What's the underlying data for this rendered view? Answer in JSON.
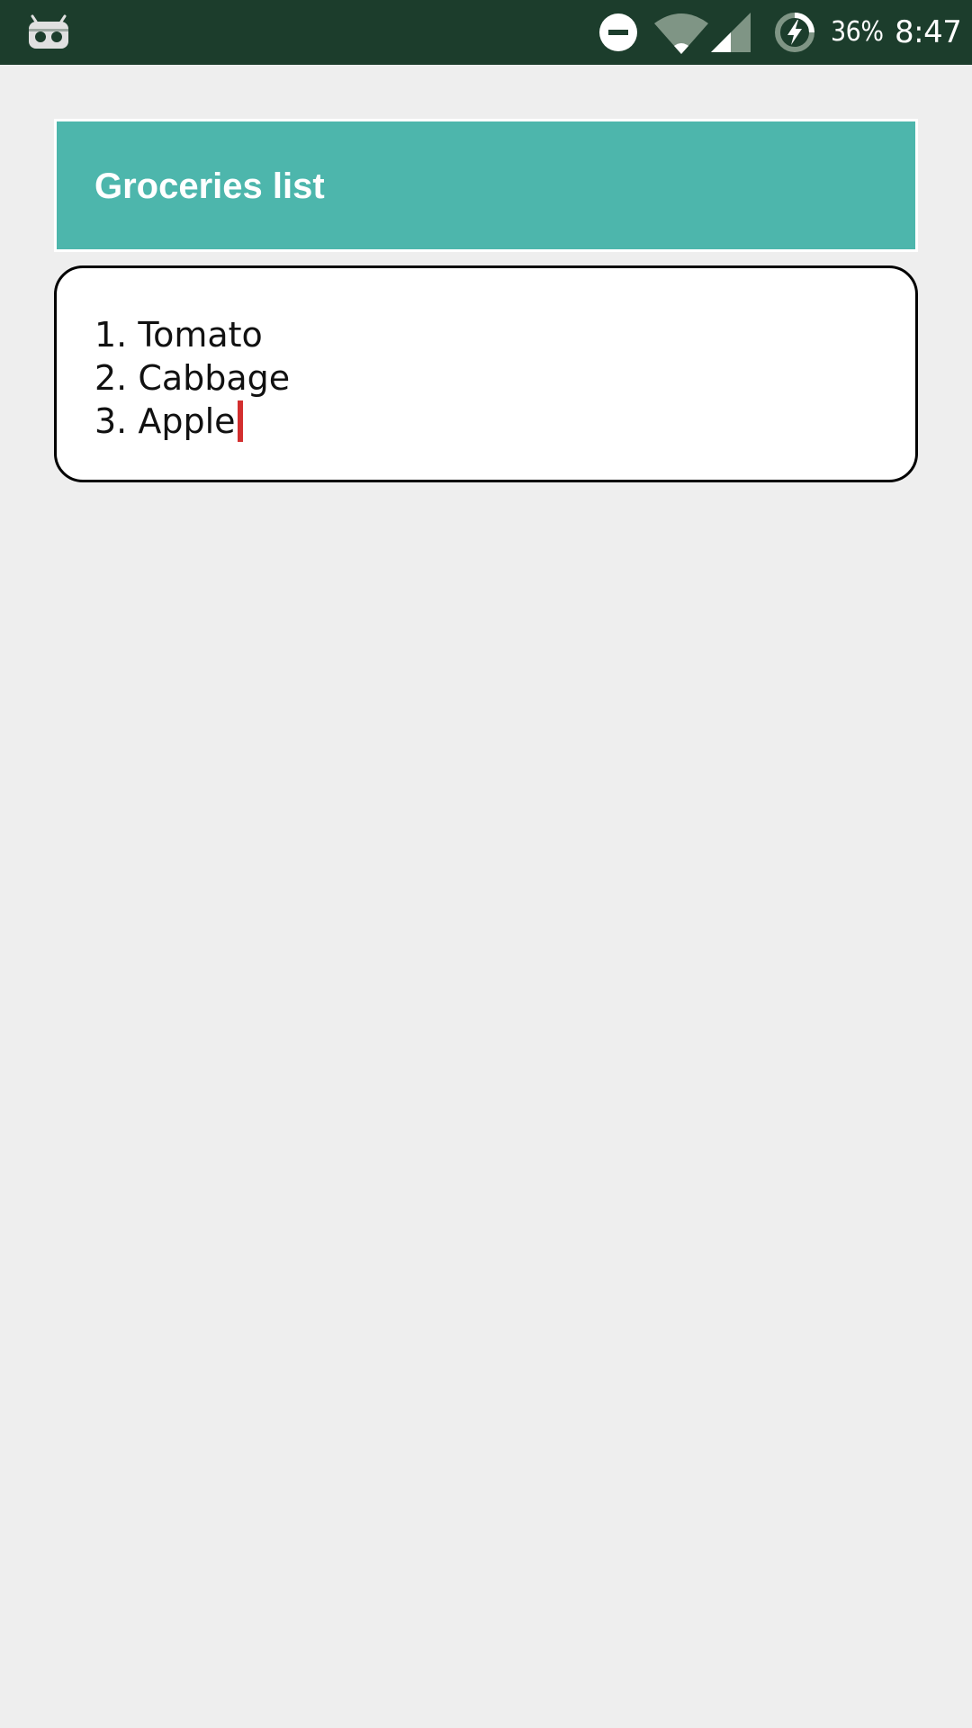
{
  "status_bar": {
    "left_icon": "cyanogen-bot-icon",
    "icons": [
      "do-not-disturb-icon",
      "wifi-icon",
      "cell-signal-icon",
      "battery-charging-icon"
    ],
    "battery_percent": "36%",
    "time": "8:47",
    "colors": {
      "background": "#1c3d2c"
    }
  },
  "header": {
    "title": "Groceries list",
    "color": "#4db6ac"
  },
  "editor": {
    "lines": [
      "1. Tomato",
      "2. Cabbage",
      "3. Apple"
    ],
    "cursor_color": "#d32f2f"
  }
}
